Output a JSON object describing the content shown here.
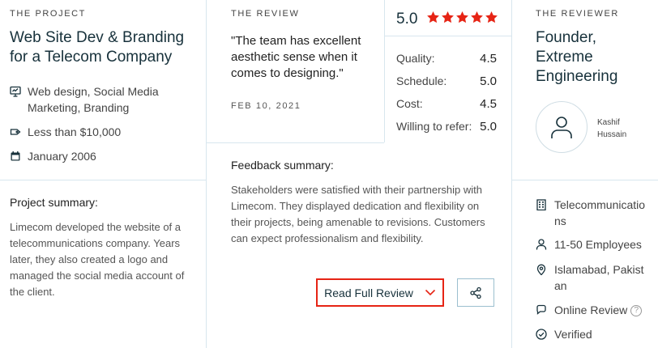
{
  "project": {
    "eyebrow": "THE PROJECT",
    "title": "Web Site Dev & Branding for a Telecom Company",
    "services": "Web design, Social Media Marketing, Branding",
    "budget": "Less than $10,000",
    "date": "January 2006",
    "summary_heading": "Project summary:",
    "summary_text": "Limecom developed the website of a telecommunications company. Years later, they also created a logo and managed the social media account of the client."
  },
  "review": {
    "eyebrow": "THE REVIEW",
    "quote": "\"The team has excellent aesthetic sense when it comes to designing.\"",
    "date": "FEB 10, 2021",
    "overall": "5.0",
    "stars": 5,
    "ratings": [
      {
        "label": "Quality:",
        "value": "4.5"
      },
      {
        "label": "Schedule:",
        "value": "5.0"
      },
      {
        "label": "Cost:",
        "value": "4.5"
      },
      {
        "label": "Willing to refer:",
        "value": "5.0"
      }
    ],
    "feedback_heading": "Feedback summary:",
    "feedback_text": "Stakeholders were satisfied with their partnership with Limecom. They displayed dedication and flexibility on their projects, being amenable to revisions. Customers can expect professionalism and flexibility.",
    "read_full_label": "Read Full Review"
  },
  "reviewer": {
    "eyebrow": "THE REVIEWER",
    "title": "Founder, Extreme Engineering",
    "name": "Kashif Hussain",
    "industry": "Telecommunications",
    "size": "11-50 Employees",
    "location": "Islamabad, Pakistan",
    "review_type": "Online Review",
    "help_mark": "?",
    "verified": "Verified"
  },
  "colors": {
    "accent_red": "#e62415",
    "star": "#e62415",
    "divider": "#d8e6ee",
    "icon": "#17313b"
  },
  "icons": [
    "monitor-icon",
    "tag-icon",
    "calendar-icon",
    "star-icon",
    "chevron-down-icon",
    "share-icon",
    "user-icon",
    "building-icon",
    "person-icon",
    "location-pin-icon",
    "chat-bubble-icon",
    "check-circle-icon",
    "help-icon"
  ]
}
